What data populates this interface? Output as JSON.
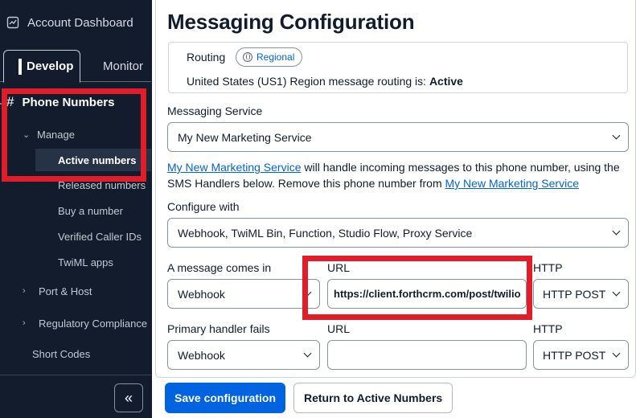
{
  "sidebar": {
    "account_label": "Account Dashboard",
    "tabs": [
      {
        "label": "Develop",
        "active": true
      },
      {
        "label": "Monitor",
        "active": false
      }
    ],
    "section_title": "Phone Numbers",
    "manage_label": "Manage",
    "manage_items": [
      {
        "label": "Active numbers",
        "active": true
      },
      {
        "label": "Released numbers"
      },
      {
        "label": "Buy a number"
      },
      {
        "label": "Verified Caller IDs"
      },
      {
        "label": "TwiML apps"
      }
    ],
    "port_host_label": "Port & Host",
    "regulatory_label": "Regulatory Compliance",
    "short_codes_label": "Short Codes",
    "collapse_glyph": "«"
  },
  "main": {
    "title": "Messaging Configuration",
    "routing": {
      "label": "Routing",
      "badge": "Regional",
      "status_prefix": "United States (US1) Region message routing is:",
      "status_value": "Active"
    },
    "messaging_service": {
      "label": "Messaging Service",
      "value": "My New Marketing Service"
    },
    "description": {
      "link1": "My New Marketing Service",
      "text1": " will handle incoming messages to this phone number, using the SMS Handlers below. Remove this phone number from ",
      "link2": "My New Marketing Service"
    },
    "configure_with": {
      "label": "Configure with",
      "value": "Webhook, TwiML Bin, Function, Studio Flow, Proxy Service"
    },
    "message_comes_in": {
      "label": "A message comes in",
      "type_value": "Webhook",
      "url_label": "URL",
      "url_value": "https://client.forthcrm.com/post/twilio",
      "http_label": "HTTP",
      "http_value": "HTTP POST"
    },
    "primary_handler_fails": {
      "label": "Primary handler fails",
      "type_value": "Webhook",
      "url_label": "URL",
      "url_value": "",
      "http_label": "HTTP",
      "http_value": "HTTP POST"
    },
    "buttons": {
      "save": "Save configuration",
      "return": "Return to Active Numbers"
    }
  },
  "colors": {
    "sidebar_bg": "#121c2d",
    "primary": "#0263e0",
    "highlight_box": "#e11d2a"
  }
}
